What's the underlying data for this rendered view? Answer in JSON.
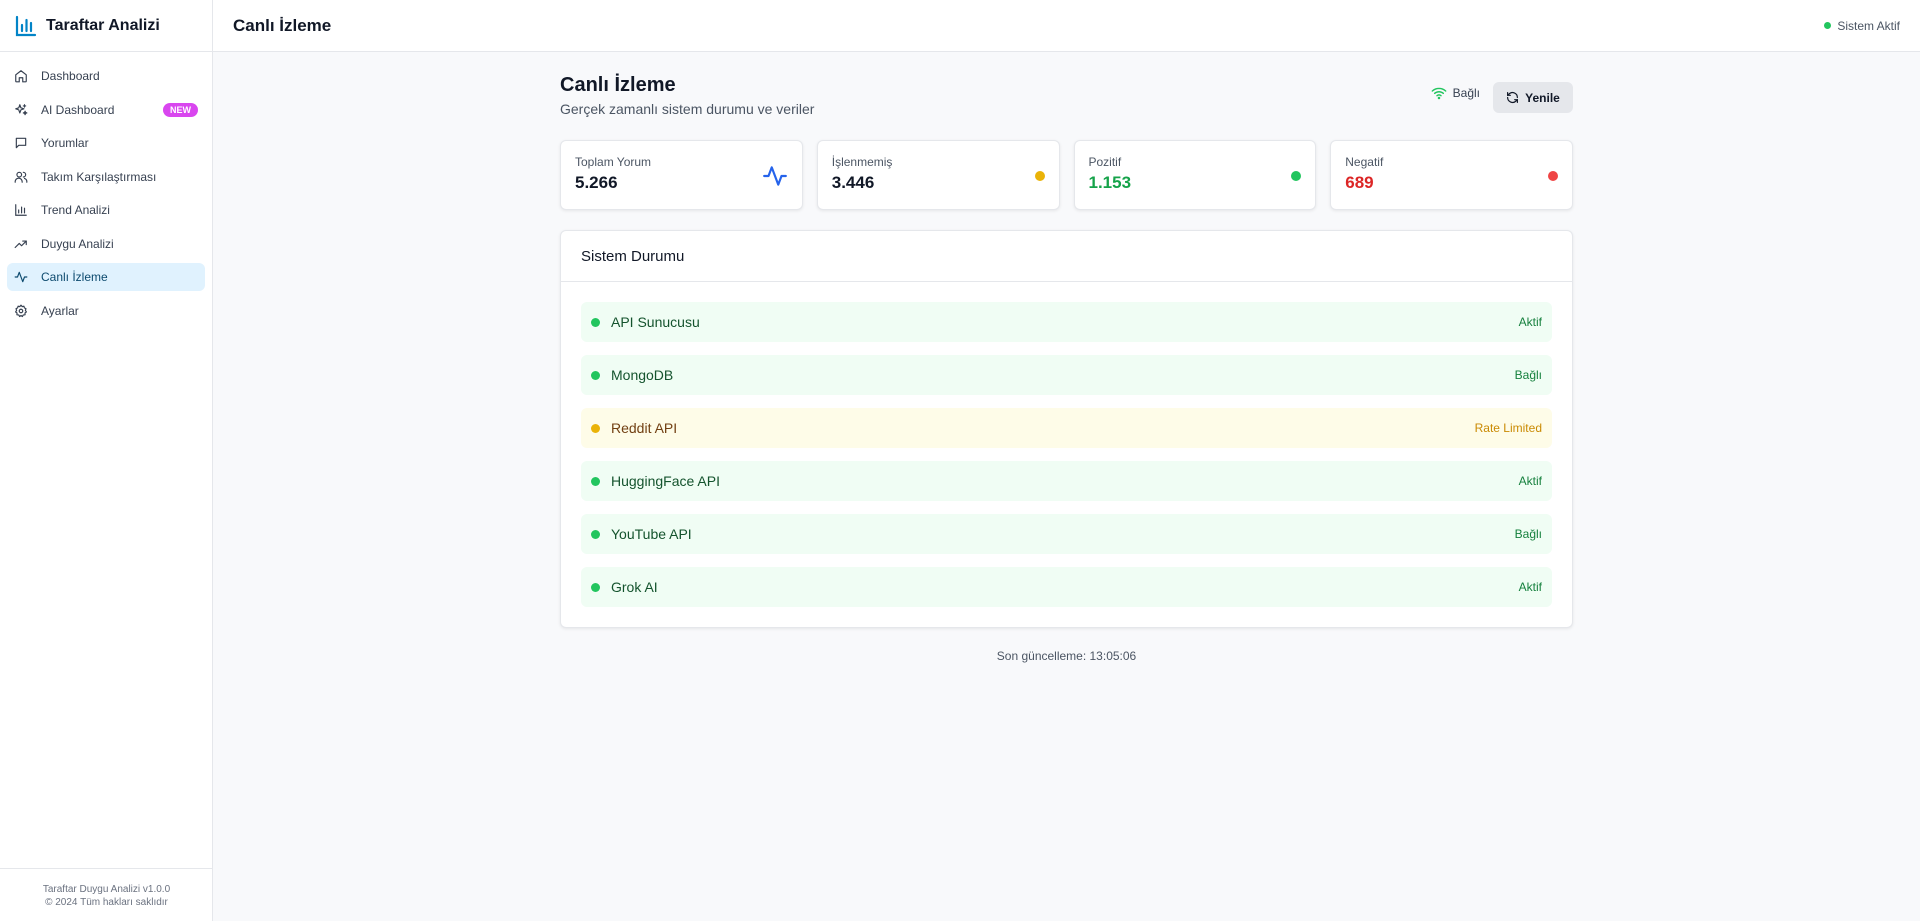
{
  "brand": {
    "title": "Taraftar Analizi",
    "accent": "#0284c7"
  },
  "sidebar": {
    "items": [
      {
        "label": "Dashboard",
        "icon": "home-icon"
      },
      {
        "label": "AI Dashboard",
        "icon": "sparkles-icon",
        "badge": "NEW"
      },
      {
        "label": "Yorumlar",
        "icon": "message-icon"
      },
      {
        "label": "Takım Karşılaştırması",
        "icon": "users-icon"
      },
      {
        "label": "Trend Analizi",
        "icon": "bar-chart-icon"
      },
      {
        "label": "Duygu Analizi",
        "icon": "trending-up-icon"
      },
      {
        "label": "Canlı İzleme",
        "icon": "activity-icon",
        "active": true
      },
      {
        "label": "Ayarlar",
        "icon": "gear-icon"
      }
    ],
    "footer": {
      "version": "Taraftar Duygu Analizi v1.0.0",
      "copyright": "© 2024 Tüm hakları saklıdır"
    }
  },
  "header": {
    "title": "Canlı İzleme",
    "status": "Sistem Aktif"
  },
  "page": {
    "title": "Canlı İzleme",
    "subtitle": "Gerçek zamanlı sistem durumu ve veriler",
    "connection": "Bağlı",
    "refresh_label": "Yenile"
  },
  "stats": [
    {
      "label": "Toplam Yorum",
      "value": "5.266",
      "value_color": "#111827",
      "indicator": "activity-icon"
    },
    {
      "label": "İşlenmemiş",
      "value": "3.446",
      "value_color": "#111827",
      "indicator_color": "#eab308"
    },
    {
      "label": "Pozitif",
      "value": "1.153",
      "value_color": "#16a34a",
      "indicator_color": "#22c55e"
    },
    {
      "label": "Negatif",
      "value": "689",
      "value_color": "#dc2626",
      "indicator_color": "#ef4444"
    }
  ],
  "system_status": {
    "title": "Sistem Durumu",
    "items": [
      {
        "name": "API Sunucusu",
        "state": "Aktif",
        "level": "ok"
      },
      {
        "name": "MongoDB",
        "state": "Bağlı",
        "level": "ok"
      },
      {
        "name": "Reddit API",
        "state": "Rate Limited",
        "level": "warn"
      },
      {
        "name": "HuggingFace API",
        "state": "Aktif",
        "level": "ok"
      },
      {
        "name": "YouTube API",
        "state": "Bağlı",
        "level": "ok"
      },
      {
        "name": "Grok AI",
        "state": "Aktif",
        "level": "ok"
      }
    ]
  },
  "last_update": "Son güncelleme: 13:05:06"
}
